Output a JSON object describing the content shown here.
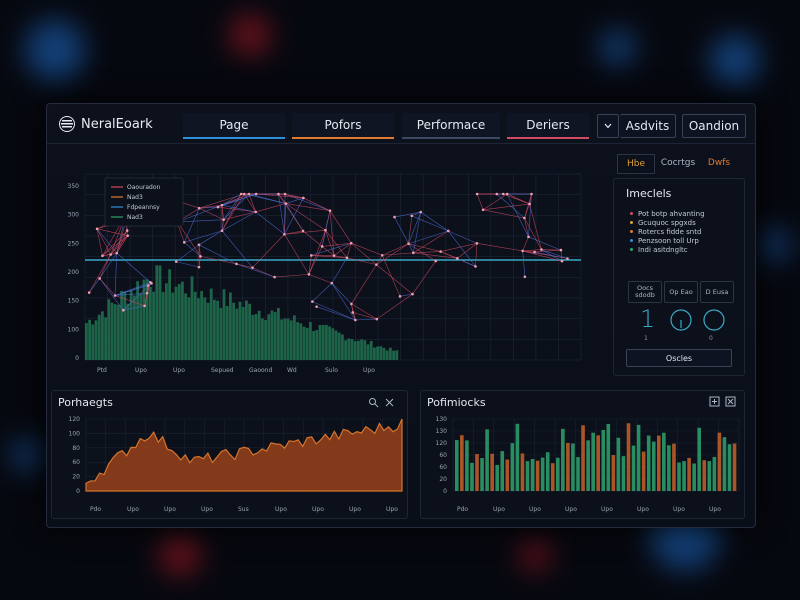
{
  "header": {
    "logo_text": "NeralEoark",
    "tabs": [
      {
        "label": "Page",
        "accent": "#2f8fd8"
      },
      {
        "label": "Pofors",
        "accent": "#e07a2e"
      },
      {
        "label": "Performace",
        "accent": "#3a4a63"
      },
      {
        "label": "Deriers",
        "accent": "#d24a63"
      }
    ],
    "dropdown_icon": "chevron-down-icon",
    "dropdown_label": "Asdvits",
    "action_label": "Oandion"
  },
  "main_chart": {
    "y_ticks": [
      "350",
      "300",
      "250",
      "200",
      "150",
      "100",
      "0"
    ],
    "x_ticks": [
      "Ptd",
      "Upo",
      "Upo",
      "Sepued",
      "Gaoond",
      "Wd",
      "Sulo",
      "Upo"
    ],
    "legend": [
      "Oaouradon",
      "Nad3",
      "Fdpeannsy",
      "Nad3"
    ],
    "legend_colors": [
      "#d24a63",
      "#e07a2e",
      "#2f8fd8",
      "#2ea56e"
    ]
  },
  "side_panel": {
    "tabs": [
      "Hbe",
      "Cocrtgs",
      "Dwfs"
    ],
    "tab_colors": [
      "#e0a030",
      "#aeb6c6",
      "#e07a2e"
    ],
    "title": "Imeclels",
    "items": [
      {
        "text": "Pot botp ahvanting",
        "color": "#d24a63"
      },
      {
        "text": "Gcuquoc spgxds",
        "color": "#e0a030"
      },
      {
        "text": "Rotercs fidde sntd",
        "color": "#e07a2e"
      },
      {
        "text": "Penzsoon toll Urp",
        "color": "#2f8fd8"
      },
      {
        "text": "Indi asitdngltc",
        "color": "#2ea56e"
      }
    ],
    "stats": [
      "Oocs sdodb",
      "Op Eao",
      "D Eusa"
    ],
    "dials": [
      "1",
      "1",
      "0"
    ],
    "button_label": "Oscles"
  },
  "bottom_left": {
    "title": "Porhaegts",
    "icons": [
      "search-icon",
      "close-icon"
    ],
    "y_ticks": [
      "120",
      "100",
      "80",
      "60",
      "20",
      "0"
    ],
    "x_ticks": [
      "Pdo",
      "Upo",
      "Upo",
      "Upo",
      "Sus",
      "Upo",
      "Upo",
      "Upo",
      "Upo"
    ]
  },
  "bottom_right": {
    "title": "Pofimiocks",
    "icons": [
      "expand-icon",
      "close-icon"
    ],
    "y_ticks": [
      "130",
      "130",
      "120",
      "60",
      "60",
      "20",
      "0"
    ],
    "x_ticks": [
      "Pdo",
      "Upo",
      "Upo",
      "Upo",
      "Upo",
      "Upo",
      "Upo",
      "Upo"
    ]
  },
  "colors": {
    "red": "#d24a63",
    "blue": "#2f8fd8",
    "orange": "#c8622a",
    "green": "#2ea56e",
    "teal": "#3aa9c8"
  }
}
